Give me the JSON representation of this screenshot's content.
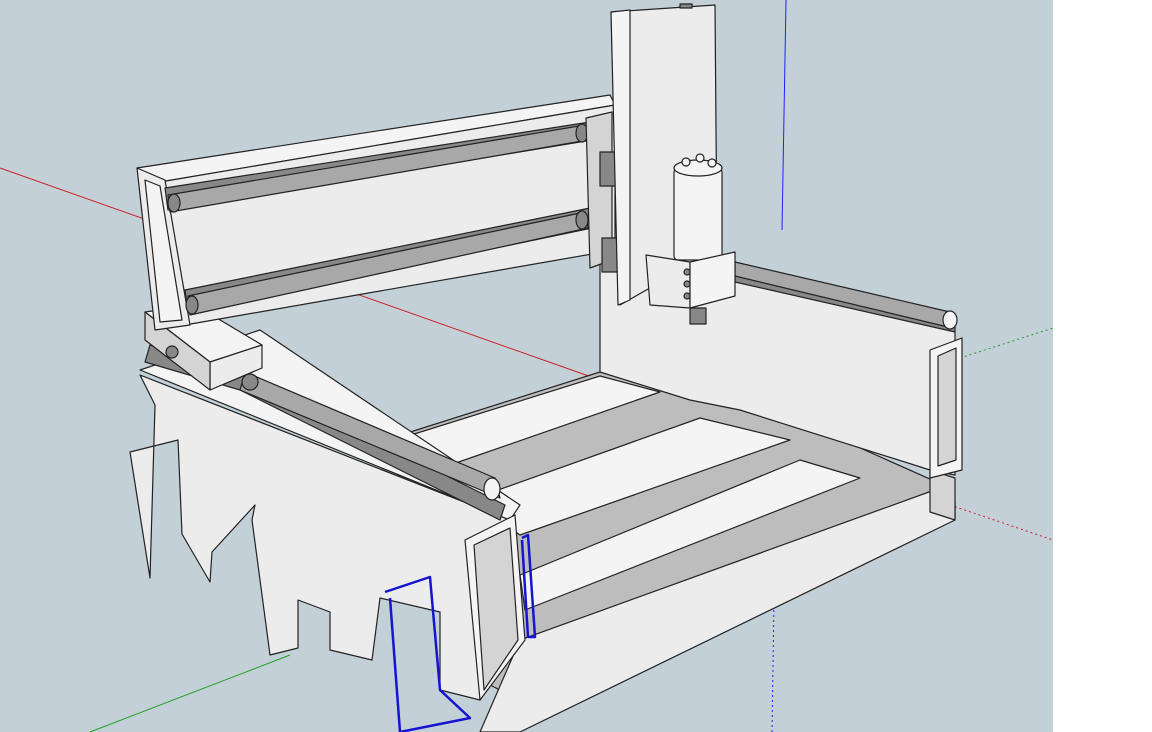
{
  "colors": {
    "sky": "#c3d0d8",
    "ground": "#bcc6c5",
    "panel": "#ececec",
    "panel_light": "#f4f4f4",
    "panel_shade": "#d4d4d4",
    "tray": "#bdbdbd",
    "rail_dark": "#888888",
    "rail": "#a8a8a8",
    "edge": "#222222",
    "selection": "#1515d0",
    "axis_red": "#c81e1e",
    "axis_green": "#1e9e1e",
    "axis_blue": "#2020ff",
    "strip": "#ffffff"
  },
  "scene": {
    "model": "cnc-router-gantry",
    "axes": [
      "red-axis",
      "green-axis",
      "blue-axis"
    ]
  }
}
